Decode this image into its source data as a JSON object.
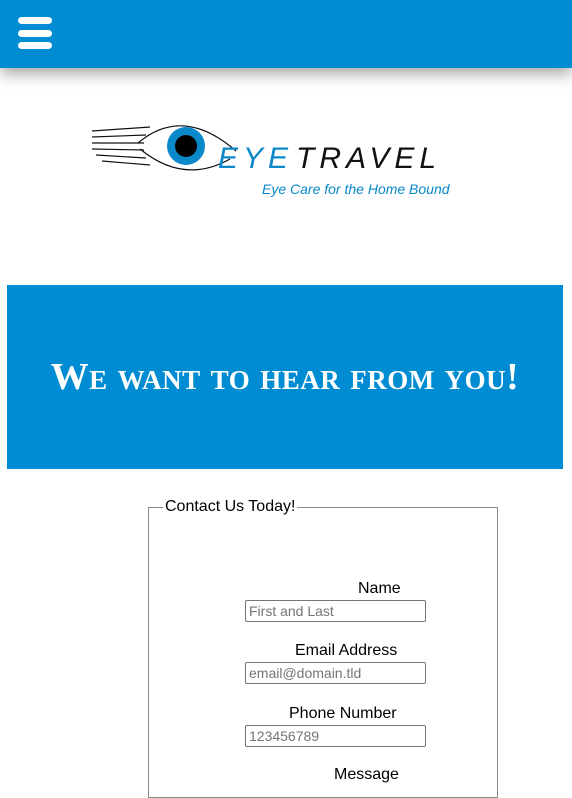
{
  "header": {
    "menu_icon": "hamburger-menu-icon",
    "background": "#008cd2"
  },
  "logo": {
    "brand_part1": "EYE",
    "brand_part2": "TRAVEL",
    "tagline": "Eye Care for the Home Bound",
    "brand_color": "#0a88c9"
  },
  "hero": {
    "heading": "We want to hear from you!"
  },
  "form": {
    "legend": "Contact Us Today!",
    "fields": [
      {
        "label": "Name",
        "placeholder": "First and Last",
        "value": ""
      },
      {
        "label": "Email Address",
        "placeholder": "email@domain.tld",
        "value": ""
      },
      {
        "label": "Phone Number",
        "placeholder": "123456789",
        "value": ""
      }
    ],
    "message_label": "Message"
  }
}
